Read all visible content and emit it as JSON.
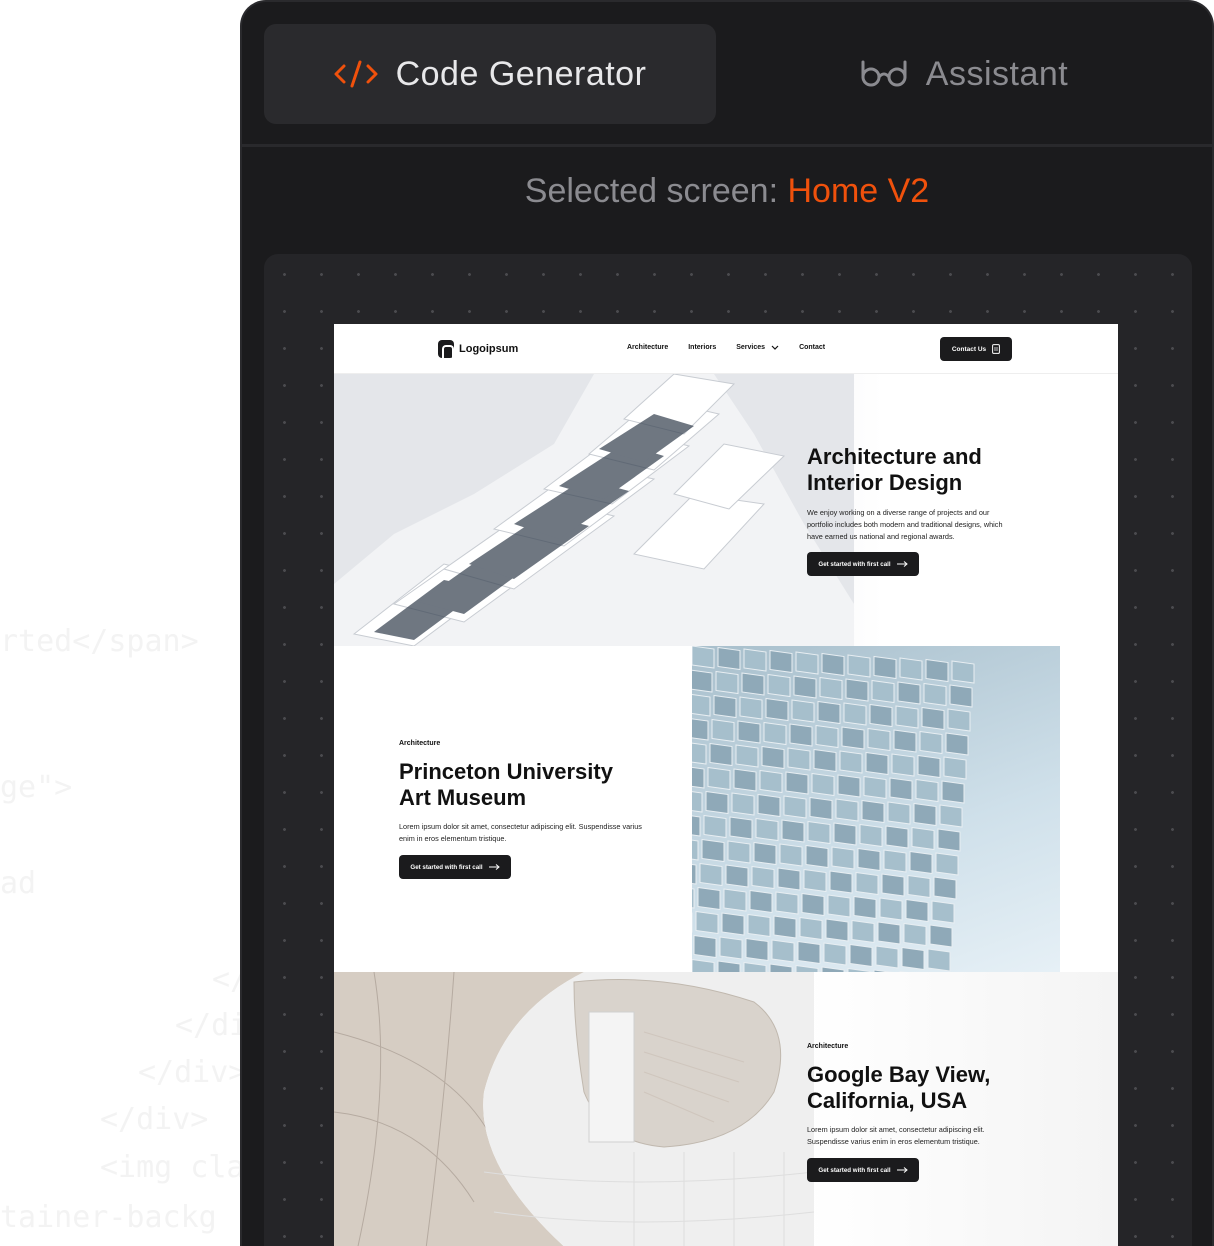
{
  "background_code": [
    "</span>",
    "</div>",
    "</div>",
    "</div>",
    "<img cla",
    "tainer-backg",
    "rted</span>",
    "ge\">",
    "ad"
  ],
  "tabs": [
    {
      "label": "Code Generator",
      "icon": "code-icon",
      "active": true
    },
    {
      "label": "Assistant",
      "icon": "glasses-icon",
      "active": false
    }
  ],
  "selected": {
    "label": "Selected screen:",
    "value": "Home V2"
  },
  "colors": {
    "accent": "#f0510c",
    "panel": "#1b1b1d",
    "button": "#1b1b1d"
  },
  "site": {
    "logo": "Logoipsum",
    "nav": [
      "Architecture",
      "Interiors",
      "Services",
      "Contact"
    ],
    "contact_button": "Contact Us",
    "hero": {
      "title": "Architecture and Interior Design",
      "description": "We enjoy working on a diverse range of projects and our portfolio includes both modern and traditional designs, which have earned us national and regional awards.",
      "button": "Get started with first call"
    },
    "feature1": {
      "category": "Architecture",
      "title": "Princeton University Art Museum",
      "description": "Lorem ipsum dolor sit amet, consectetur adipiscing elit. Suspendisse varius enim in eros elementum tristique.",
      "button": "Get started with first call"
    },
    "feature2": {
      "category": "Architecture",
      "title": "Google Bay View, California, USA",
      "description": "Lorem ipsum dolor sit amet, consectetur adipiscing elit. Suspendisse varius enim in eros elementum tristique.",
      "button": "Get started with first call"
    }
  }
}
